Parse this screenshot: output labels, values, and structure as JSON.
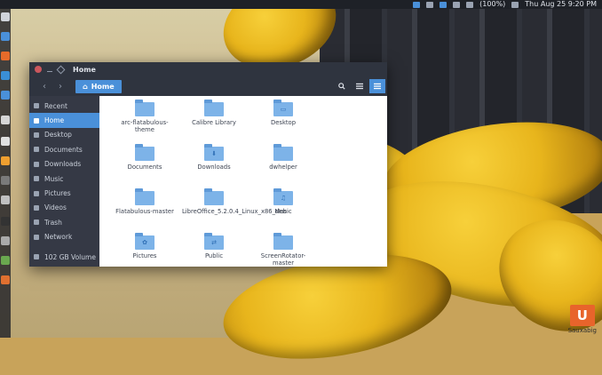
{
  "top_panel": {
    "battery": "(100%)",
    "datetime": "Thu Aug 25  9:20 PM"
  },
  "window": {
    "title": "Home",
    "breadcrumb": "Home"
  },
  "sidebar": {
    "items": [
      {
        "label": "Recent"
      },
      {
        "label": "Home"
      },
      {
        "label": "Desktop"
      },
      {
        "label": "Documents"
      },
      {
        "label": "Downloads"
      },
      {
        "label": "Music"
      },
      {
        "label": "Pictures"
      },
      {
        "label": "Videos"
      },
      {
        "label": "Trash"
      },
      {
        "label": "Network"
      },
      {
        "label": "102 GB Volume"
      }
    ]
  },
  "files": [
    {
      "name": "arc-flatabulous-theme",
      "glyph": ""
    },
    {
      "name": "Calibre Library",
      "glyph": ""
    },
    {
      "name": "Desktop",
      "glyph": "▭"
    },
    {
      "name": "Documents",
      "glyph": ""
    },
    {
      "name": "Downloads",
      "glyph": "⬇"
    },
    {
      "name": "dwhelper",
      "glyph": ""
    },
    {
      "name": "Flatabulous-master",
      "glyph": ""
    },
    {
      "name": "LibreOffice_5.2.0.4_Linux_x86_deb",
      "glyph": ""
    },
    {
      "name": "Music",
      "glyph": "♫"
    },
    {
      "name": "Pictures",
      "glyph": "✿"
    },
    {
      "name": "Public",
      "glyph": "⇄"
    },
    {
      "name": "ScreenRotator-master",
      "glyph": ""
    }
  ],
  "watermark": {
    "logo": "U",
    "text": "Sauxabig"
  }
}
